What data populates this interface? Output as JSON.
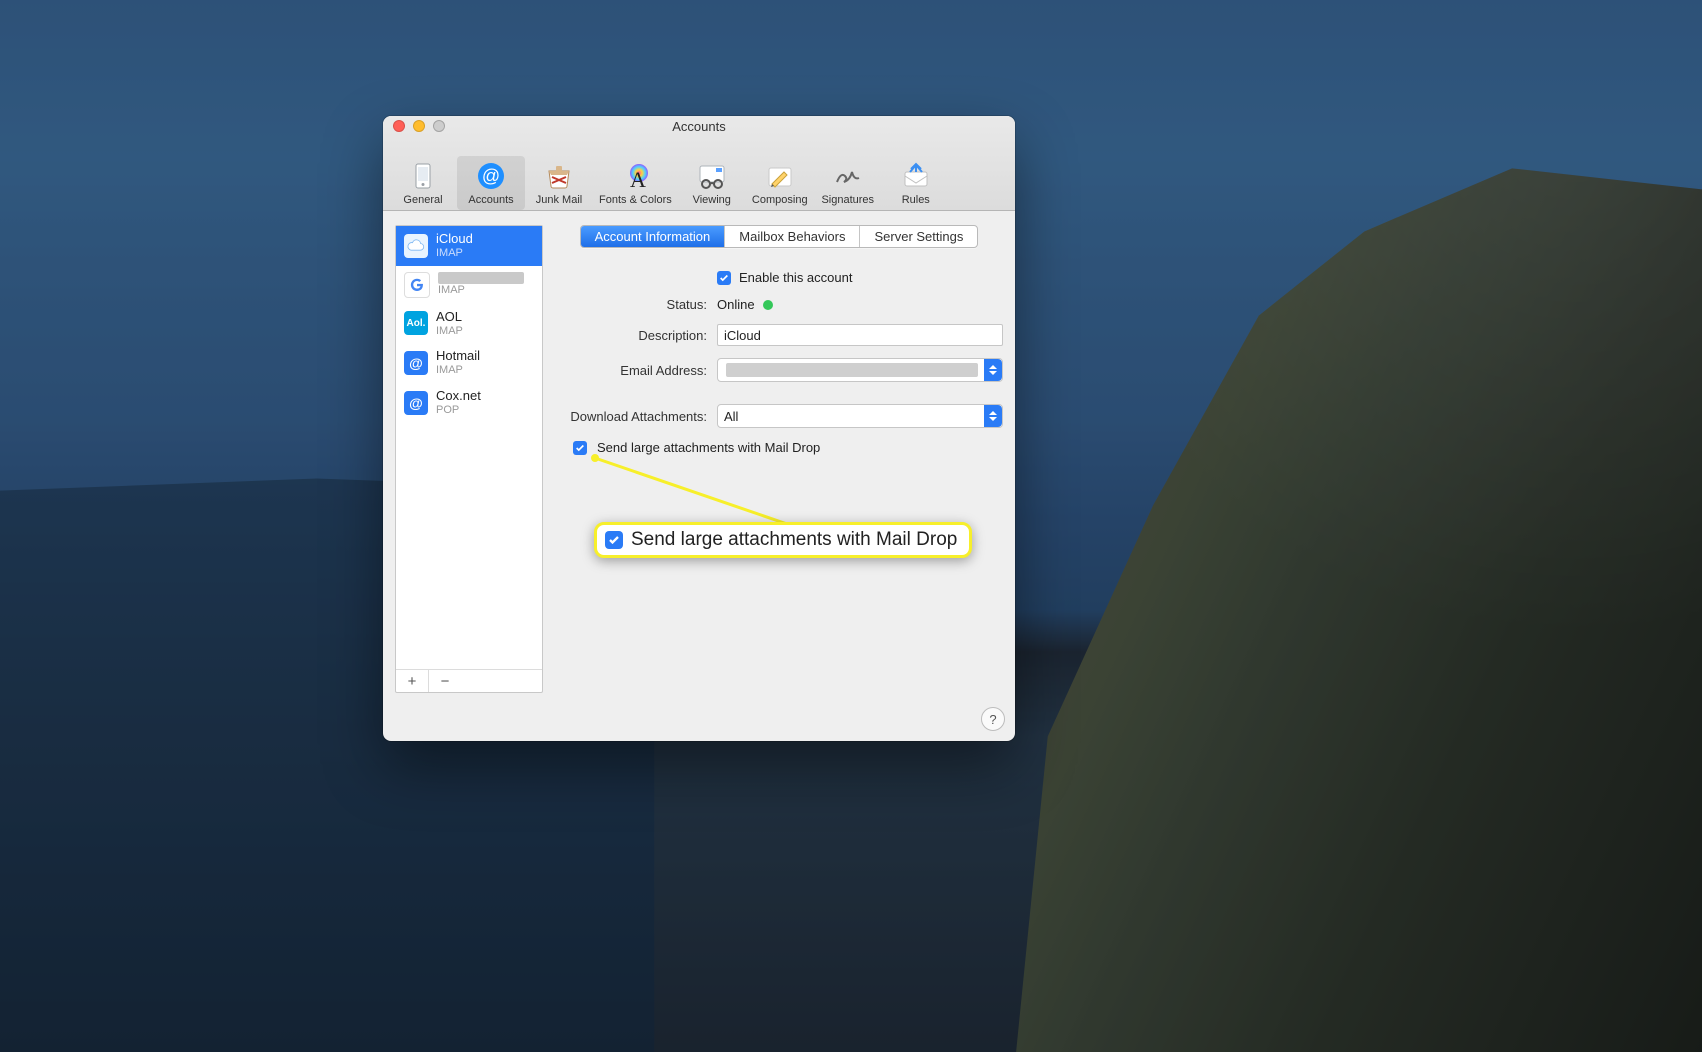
{
  "window": {
    "title": "Accounts",
    "toolbar": [
      {
        "id": "general",
        "label": "General"
      },
      {
        "id": "accounts",
        "label": "Accounts",
        "selected": true
      },
      {
        "id": "junk",
        "label": "Junk Mail"
      },
      {
        "id": "fonts",
        "label": "Fonts & Colors"
      },
      {
        "id": "viewing",
        "label": "Viewing"
      },
      {
        "id": "composing",
        "label": "Composing"
      },
      {
        "id": "signatures",
        "label": "Signatures"
      },
      {
        "id": "rules",
        "label": "Rules"
      }
    ]
  },
  "accounts": [
    {
      "name": "iCloud",
      "protocol": "IMAP",
      "iconClass": "icloud",
      "selected": true
    },
    {
      "name": "",
      "protocol": "IMAP",
      "iconClass": "google",
      "redacted": true
    },
    {
      "name": "AOL",
      "protocol": "IMAP",
      "iconClass": "aol"
    },
    {
      "name": "Hotmail",
      "protocol": "IMAP",
      "iconClass": "imap"
    },
    {
      "name": "Cox.net",
      "protocol": "POP",
      "iconClass": "cox"
    }
  ],
  "sidebar_buttons": {
    "add": "+",
    "remove": "−"
  },
  "tabs": {
    "account_info": "Account Information",
    "mailbox_behaviors": "Mailbox Behaviors",
    "server_settings": "Server Settings"
  },
  "form": {
    "enable_label": "Enable this account",
    "enable_checked": true,
    "status_label": "Status:",
    "status_value": "Online",
    "status_color": "#34c759",
    "description_label": "Description:",
    "description_value": "iCloud",
    "email_label": "Email Address:",
    "email_value": "",
    "download_label": "Download Attachments:",
    "download_value": "All",
    "maildrop_label": "Send large attachments with Mail Drop",
    "maildrop_checked": true
  },
  "annotation": {
    "text": "Send large attachments with Mail Drop"
  },
  "help_label": "?"
}
